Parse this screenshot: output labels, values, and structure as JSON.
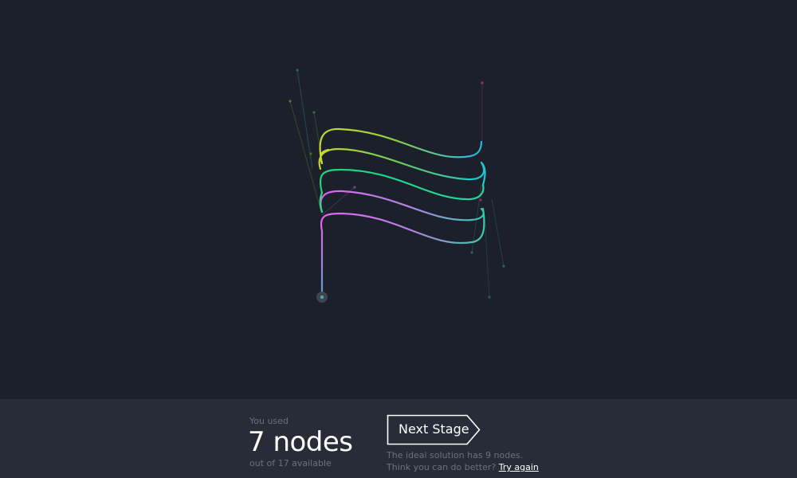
{
  "result": {
    "used_caption": "You used",
    "used_value": "7 nodes",
    "available_text": "out of 17 available"
  },
  "actions": {
    "next_stage_label": "Next Stage",
    "ideal_text": "The ideal solution has 9 nodes. Think you can do better?",
    "try_again_label": "Try again"
  },
  "colors": {
    "background": "#1b202b",
    "footer": "#272c38",
    "curve_yellow": "#c6d92a",
    "curve_green": "#1fd67a",
    "curve_pink": "#e463f0",
    "curve_cyan": "#23b6e6",
    "curve_teal": "#36c8b0",
    "curve_purple": "#a58be0",
    "start_node": "#3f4550"
  },
  "icons": {
    "next_button_shape": "arrow-tag-right"
  }
}
